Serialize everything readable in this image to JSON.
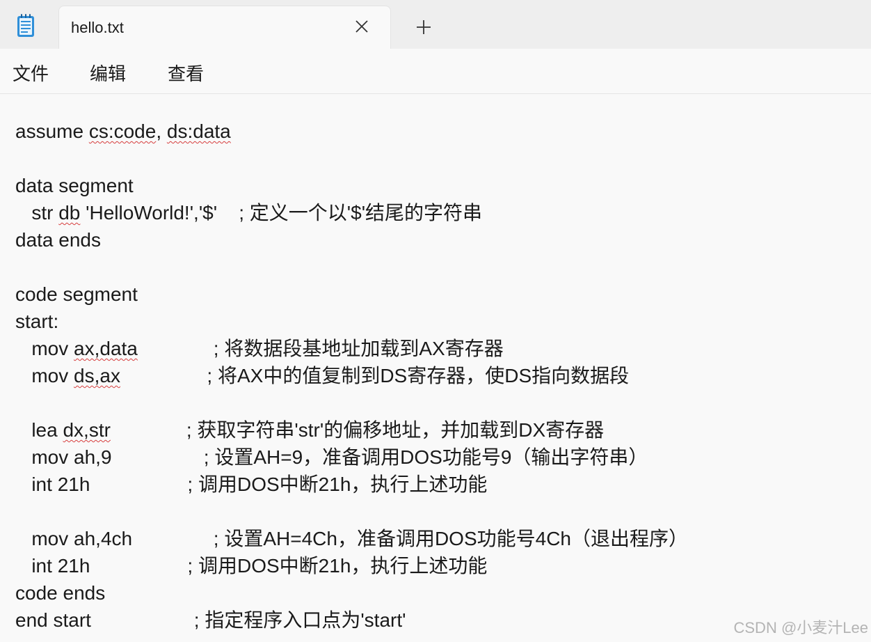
{
  "window": {
    "tab_title": "hello.txt",
    "icons": {
      "app": "notepad-icon",
      "close": "close-icon",
      "new_tab": "plus-icon"
    }
  },
  "menu": {
    "items": [
      "文件",
      "编辑",
      "查看"
    ]
  },
  "editor": {
    "lines": [
      {
        "segments": [
          {
            "t": "assume "
          },
          {
            "t": "cs:code",
            "sq": true
          },
          {
            "t": ", "
          },
          {
            "t": "ds:data",
            "sq": true
          }
        ]
      },
      {
        "segments": []
      },
      {
        "segments": [
          {
            "t": "data segment"
          }
        ]
      },
      {
        "segments": [
          {
            "t": "   str "
          },
          {
            "t": "db",
            "sq": true
          },
          {
            "t": " 'HelloWorld!','$'    ; 定义一个以'$'结尾的字符串"
          }
        ]
      },
      {
        "segments": [
          {
            "t": "data ends"
          }
        ]
      },
      {
        "segments": []
      },
      {
        "segments": [
          {
            "t": "code segment"
          }
        ]
      },
      {
        "segments": [
          {
            "t": "start:"
          }
        ]
      },
      {
        "segments": [
          {
            "t": "   mov "
          },
          {
            "t": "ax,data",
            "sq": true
          },
          {
            "t": "              ; 将数据段基地址加载到AX寄存器"
          }
        ]
      },
      {
        "segments": [
          {
            "t": "   mov "
          },
          {
            "t": "ds,ax",
            "sq": true
          },
          {
            "t": "                ; 将AX中的值复制到DS寄存器，使DS指向数据段"
          }
        ]
      },
      {
        "segments": []
      },
      {
        "segments": [
          {
            "t": "   lea "
          },
          {
            "t": "dx,str",
            "sq": true
          },
          {
            "t": "              ; 获取字符串'str'的偏移地址，并加载到DX寄存器"
          }
        ]
      },
      {
        "segments": [
          {
            "t": "   mov ah,9                 ; 设置AH=9，准备调用DOS功能号9（输出字符串）"
          }
        ]
      },
      {
        "segments": [
          {
            "t": "   int 21h                  ; 调用DOS中断21h，执行上述功能"
          }
        ]
      },
      {
        "segments": []
      },
      {
        "segments": [
          {
            "t": "   mov ah,4ch               ; 设置AH=4Ch，准备调用DOS功能号4Ch（退出程序）"
          }
        ]
      },
      {
        "segments": [
          {
            "t": "   int 21h                  ; 调用DOS中断21h，执行上述功能"
          }
        ]
      },
      {
        "segments": [
          {
            "t": "code ends"
          }
        ]
      },
      {
        "segments": [
          {
            "t": "end start                   ; 指定程序入口点为'start'"
          }
        ]
      }
    ]
  },
  "watermark": "CSDN @小麦汁Lee"
}
